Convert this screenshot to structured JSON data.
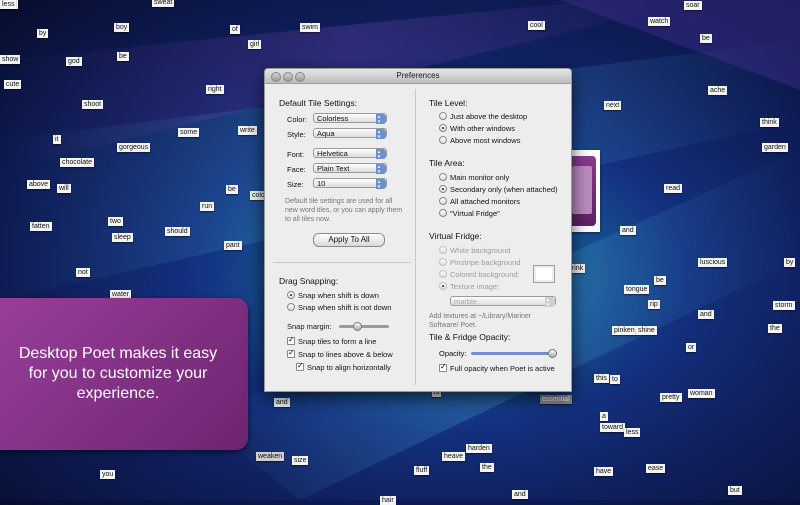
{
  "background_words": [
    "sweat",
    "soar",
    "by",
    "boy",
    "of",
    "swim",
    "cool",
    "watch",
    "be",
    "god",
    "be",
    "girl",
    "show",
    "cute",
    "right",
    "ache",
    "shoot",
    "next",
    "think",
    "some",
    "write",
    "it",
    "gorgeous",
    "garden",
    "chocolate",
    "above",
    "will",
    "be",
    "cold",
    "read",
    "run",
    "two",
    "fatten",
    "should",
    "sleep",
    "and",
    "pant",
    "not",
    "luscious",
    "by",
    "water",
    "drink",
    "be",
    "tongue",
    "rip",
    "storm",
    "and",
    "pinken",
    "shine",
    "the",
    "or",
    "to",
    "this",
    "woman",
    "pretty",
    "essential",
    "and",
    "is",
    "a",
    "toward",
    "less",
    "weaken",
    "size",
    "heave",
    "harden",
    "fluff",
    "the",
    "have",
    "ease",
    "you",
    "but",
    "and",
    "hair",
    "so",
    "from",
    "a",
    "less"
  ],
  "callout": {
    "text": "Desktop Poet makes it easy for you to customize your experience."
  },
  "window": {
    "title": "Preferences",
    "default_tile": {
      "heading": "Default Tile Settings:",
      "color_label": "Color:",
      "color_value": "Colorless",
      "style_label": "Style:",
      "style_value": "Aqua",
      "font_label": "Font:",
      "font_value": "Helvetica",
      "face_label": "Face:",
      "face_value": "Plain Text",
      "size_label": "Size:",
      "size_value": "10",
      "note": "Default tile settings are used for all new word tiles, or you can apply them to all tiles now.",
      "apply_button": "Apply To All"
    },
    "drag_snapping": {
      "heading": "Drag Snapping:",
      "option_shift_down": "Snap when shift is down",
      "option_shift_not_down": "Snap when shift is not down",
      "margin_label": "Snap margin:",
      "snap_line": "Snap tiles to form a line",
      "snap_above_below": "Snap to lines above & below",
      "snap_horizontal": "Snap to align horizontally"
    },
    "tile_level": {
      "heading": "Tile Level:",
      "options": [
        "Just above the desktop",
        "With other windows",
        "Above most windows"
      ],
      "selected": 1
    },
    "tile_area": {
      "heading": "Tile Area:",
      "options": [
        "Main monitor only",
        "Secondary only (when attached)",
        "All attached monitors",
        "\"Virtual Fridge\""
      ],
      "selected": 1
    },
    "virtual_fridge": {
      "heading": "Virtual Fridge:",
      "options": [
        "White background",
        "Pinstripe background",
        "Colored background:",
        "Texture image:"
      ],
      "texture_value": "marble",
      "note": "Add textures at ~/Library/Mariner Software/ Poet."
    },
    "opacity": {
      "heading": "Tile & Fridge Opacity:",
      "opacity_label": "Opacity:",
      "full_opacity": "Full opacity when Poet is active"
    }
  }
}
